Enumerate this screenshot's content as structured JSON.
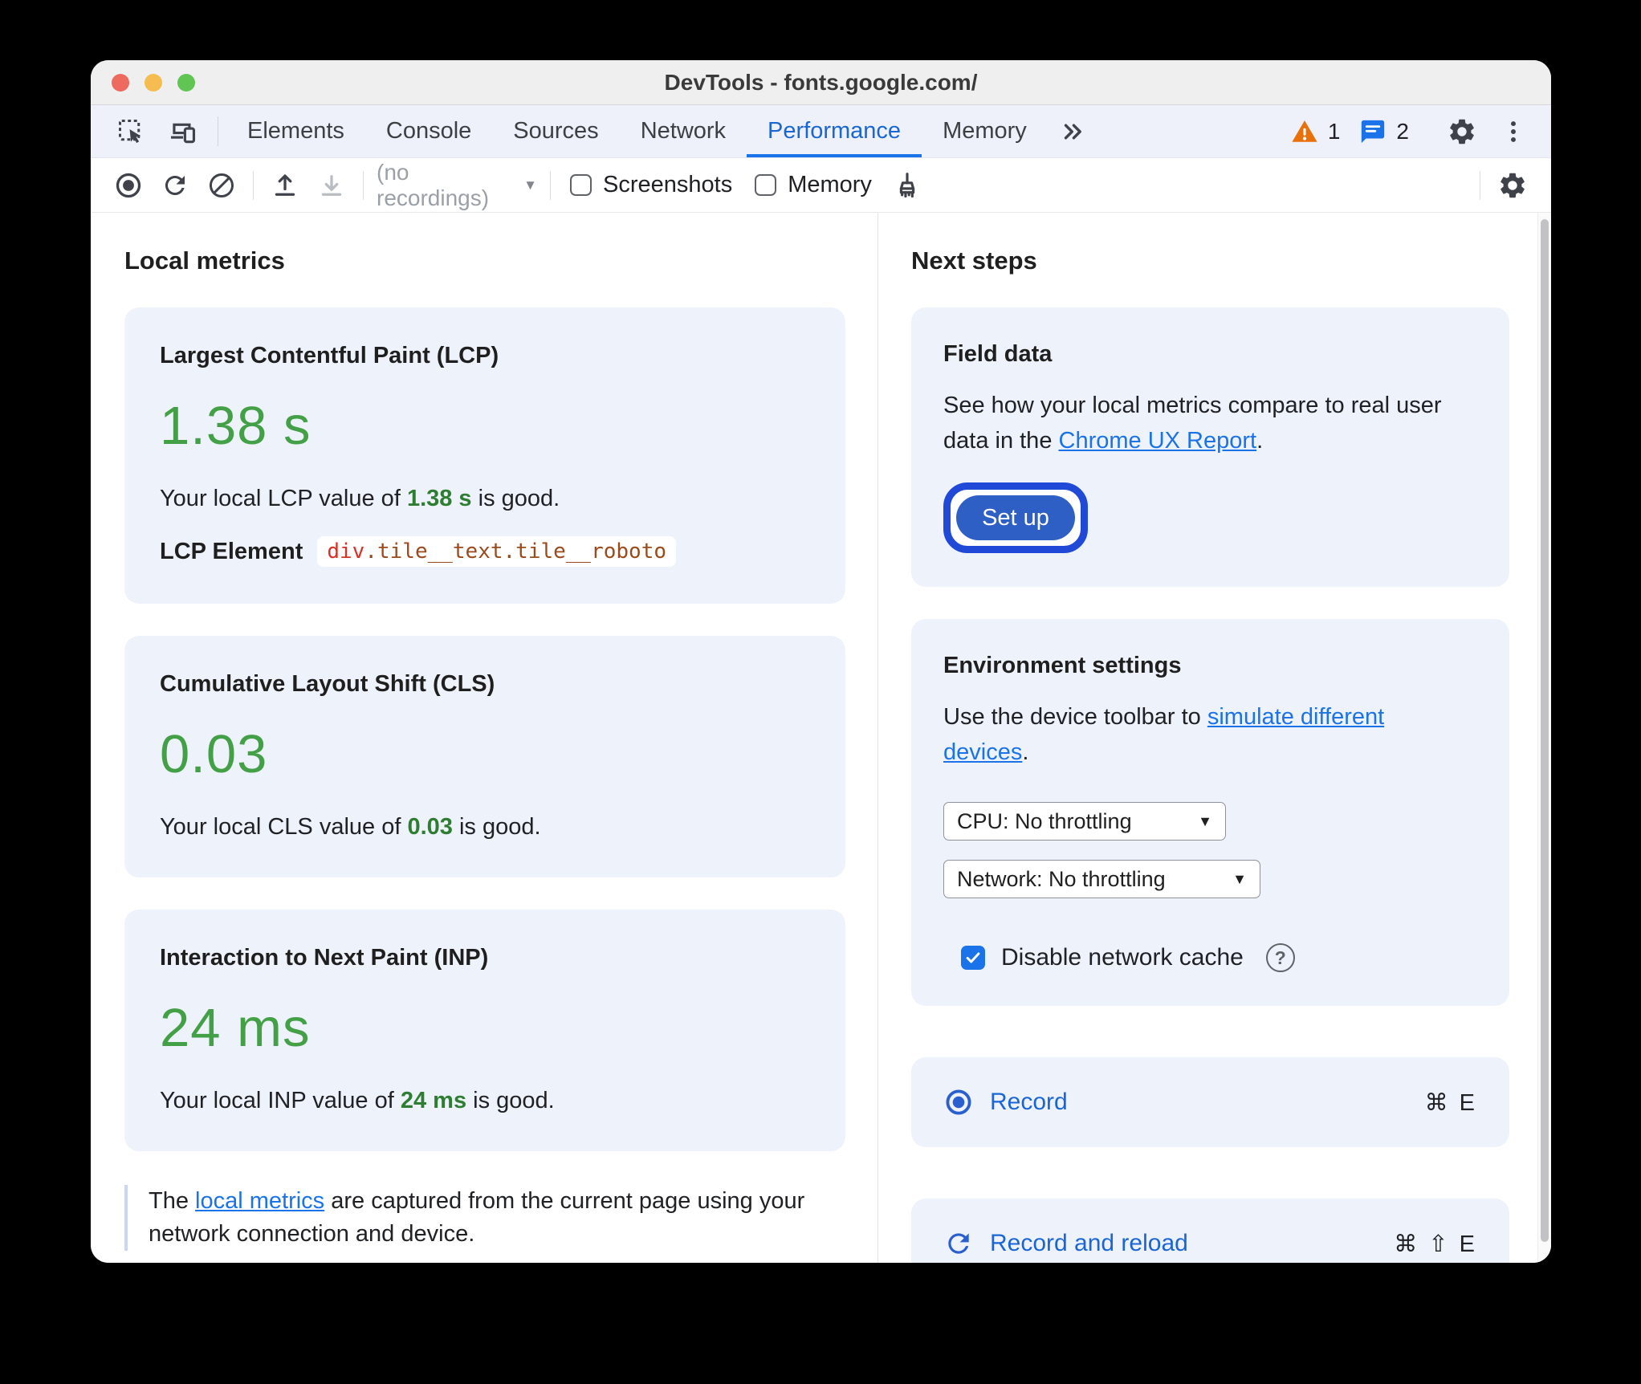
{
  "window": {
    "title": "DevTools - fonts.google.com/"
  },
  "tabs": {
    "items": [
      "Elements",
      "Console",
      "Sources",
      "Network",
      "Performance",
      "Memory"
    ],
    "active": "Performance",
    "warning_count": "1",
    "message_count": "2"
  },
  "toolbar": {
    "recordings_value": "(no recordings)",
    "screenshots_label": "Screenshots",
    "memory_label": "Memory"
  },
  "icons": {
    "dropdown_glyph": "▼",
    "help_glyph": "?"
  },
  "local_metrics": {
    "heading": "Local metrics",
    "cards": [
      {
        "title": "Largest Contentful Paint (LCP)",
        "value": "1.38 s",
        "desc_prefix": "Your local LCP value of ",
        "desc_value": "1.38 s",
        "desc_suffix": " is good.",
        "element_label": "LCP Element",
        "element_tag": "div",
        "element_classes": ".tile__text.tile__roboto"
      },
      {
        "title": "Cumulative Layout Shift (CLS)",
        "value": "0.03",
        "desc_prefix": "Your local CLS value of ",
        "desc_value": "0.03",
        "desc_suffix": " is good."
      },
      {
        "title": "Interaction to Next Paint (INP)",
        "value": "24 ms",
        "desc_prefix": "Your local INP value of ",
        "desc_value": "24 ms",
        "desc_suffix": " is good."
      }
    ],
    "footnote": {
      "prefix": "The ",
      "link": "local metrics",
      "suffix": " are captured from the current page using your network connection and device."
    }
  },
  "next_steps": {
    "heading": "Next steps",
    "field_data": {
      "title": "Field data",
      "text_prefix": "See how your local metrics compare to real user data in the ",
      "link": "Chrome UX Report",
      "text_suffix": ".",
      "button_label": "Set up"
    },
    "environment": {
      "title": "Environment settings",
      "text_prefix": "Use the device toolbar to ",
      "link": "simulate different devices",
      "text_suffix": ".",
      "cpu_value": "CPU: No throttling",
      "network_value": "Network: No throttling",
      "cache_label": "Disable network cache"
    },
    "record": {
      "label": "Record",
      "shortcut": "⌘ E"
    },
    "record_reload": {
      "label": "Record and reload",
      "shortcut": "⌘ ⇧ E"
    }
  },
  "colors": {
    "accent_blue": "#1a73e8",
    "active_tab_blue": "#1967d2",
    "good_green_large": "#43a047",
    "good_green_inline": "#2e7d32",
    "card_background": "#eef2fb",
    "warning_orange": "#e8710a",
    "setup_button_fill": "#2d5fc4",
    "setup_focus_ring": "#2149d8",
    "element_tag_red": "#d93025",
    "element_class_brown": "#9a4a1d"
  }
}
